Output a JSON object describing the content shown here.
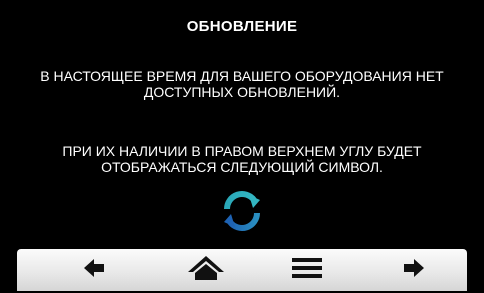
{
  "screen": {
    "title": "ОБНОВЛЕНИЕ",
    "message_no_updates": "В НАСТОЯЩЕЕ ВРЕМЯ ДЛЯ ВАШЕГО ОБОРУДОВАНИЯ НЕТ ДОСТУПНЫХ ОБНОВЛЕНИЙ.",
    "message_symbol_info": "ПРИ ИХ НАЛИЧИИ В ПРАВОМ ВЕРХНЕМ УГЛУ БУДЕТ ОТОБРАЖАТЬСЯ СЛЕДУЮЩИЙ СИМВОЛ.",
    "update_symbol_icon": "sync-arrows-icon"
  },
  "navbar": {
    "items": [
      {
        "icon": "arrow-left-icon"
      },
      {
        "icon": "home-icon"
      },
      {
        "icon": "menu-icon"
      },
      {
        "icon": "arrow-right-icon"
      }
    ]
  },
  "colors": {
    "background": "#000000",
    "text": "#ffffff",
    "sync_icon_top": "#2aa8b8",
    "sync_icon_bottom": "#1e63b4",
    "navbar_bg": "#e8e8e8",
    "nav_icon": "#111111"
  }
}
